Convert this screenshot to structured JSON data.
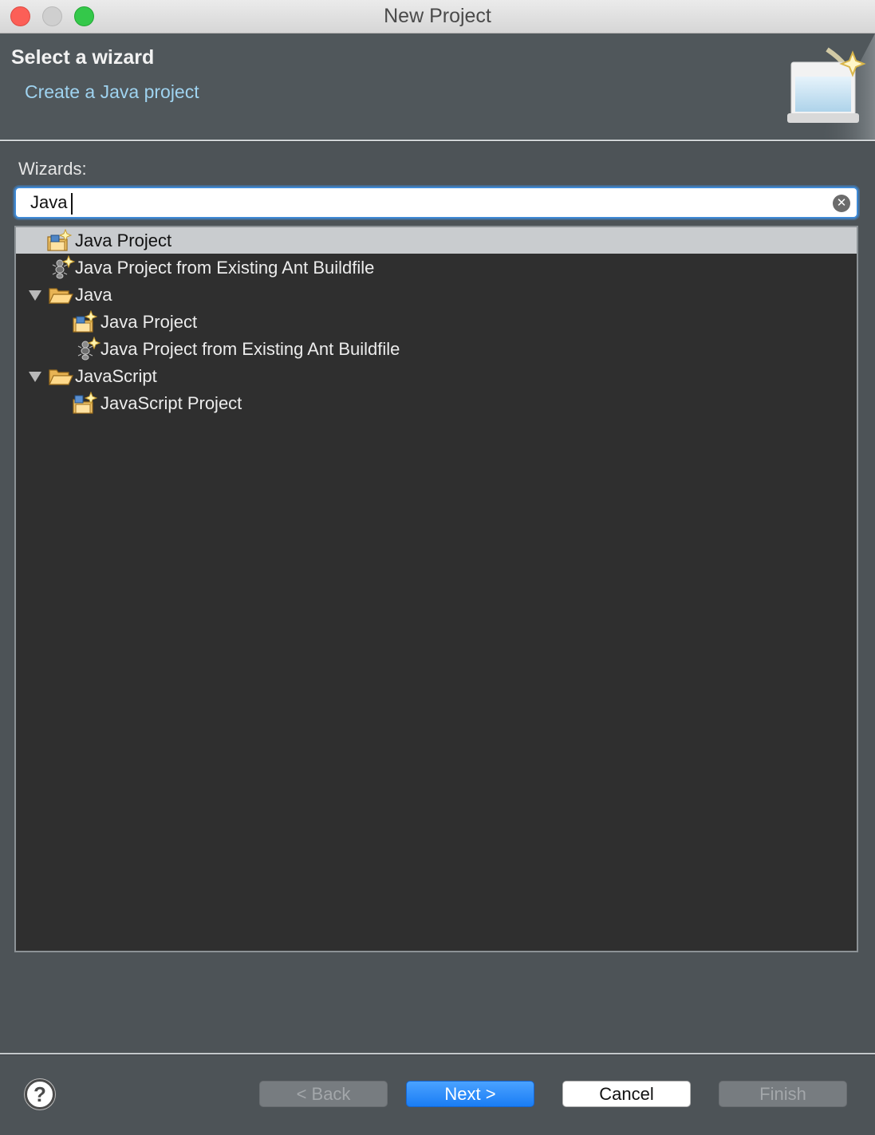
{
  "window": {
    "title": "New Project",
    "controls": [
      "close",
      "minimize",
      "maximize"
    ]
  },
  "header": {
    "title": "Select a wizard",
    "description": "Create a Java project",
    "banner_icon": "new-wizard-banner-icon"
  },
  "filter": {
    "label": "Wizards:",
    "value": "Java",
    "clear_icon": "clear-icon"
  },
  "tree": {
    "items": [
      {
        "label": "Java Project",
        "depth": 0,
        "icon": "java-project-icon",
        "selected": true
      },
      {
        "label": "Java Project from Existing Ant Buildfile",
        "depth": 0,
        "icon": "ant-buildfile-icon",
        "selected": false
      },
      {
        "label": "Java",
        "depth": 0,
        "icon": "folder-open-icon",
        "expanded": true
      },
      {
        "label": "Java Project",
        "depth": 1,
        "icon": "java-project-icon",
        "selected": false
      },
      {
        "label": "Java Project from Existing Ant Buildfile",
        "depth": 1,
        "icon": "ant-buildfile-icon",
        "selected": false
      },
      {
        "label": "JavaScript",
        "depth": 0,
        "icon": "folder-open-icon",
        "expanded": true
      },
      {
        "label": "JavaScript Project",
        "depth": 1,
        "icon": "javascript-project-icon",
        "selected": false
      }
    ]
  },
  "footer": {
    "help_icon": "help-icon",
    "help_glyph": "?",
    "back_label": "< Back",
    "next_label": "Next >",
    "cancel_label": "Cancel",
    "finish_label": "Finish"
  },
  "colors": {
    "accent": "#1a7df5",
    "selection": "#c9cccf",
    "link_text": "#9fd3f0",
    "tree_bg": "#2f2f2f",
    "dialog_bg": "#4d5357"
  }
}
